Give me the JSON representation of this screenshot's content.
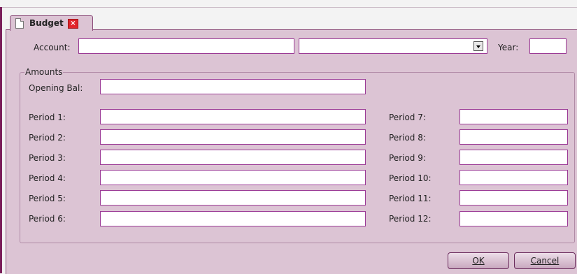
{
  "tab": {
    "title": "Budget",
    "close_glyph": "×"
  },
  "header": {
    "account_label": "Account:",
    "account_value": "",
    "account_name_value": "",
    "year_label": "Year:",
    "year_value": ""
  },
  "amounts": {
    "legend": "Amounts",
    "opening_bal_label": "Opening Bal:",
    "opening_bal_value": "",
    "periods": [
      {
        "label": "Period 1:",
        "value": ""
      },
      {
        "label": "Period 2:",
        "value": ""
      },
      {
        "label": "Period 3:",
        "value": ""
      },
      {
        "label": "Period 4:",
        "value": ""
      },
      {
        "label": "Period 5:",
        "value": ""
      },
      {
        "label": "Period 6:",
        "value": ""
      },
      {
        "label": "Period 7:",
        "value": ""
      },
      {
        "label": "Period 8:",
        "value": ""
      },
      {
        "label": "Period 9:",
        "value": ""
      },
      {
        "label": "Period 10:",
        "value": ""
      },
      {
        "label": "Period 11:",
        "value": ""
      },
      {
        "label": "Period 12:",
        "value": ""
      }
    ]
  },
  "buttons": {
    "ok": "OK",
    "cancel": "Cancel"
  },
  "icons": {
    "tab": "document-icon",
    "close": "close-icon",
    "dropdown": "chevron-down-icon"
  },
  "colors": {
    "panel_bg": "#dcc4d4",
    "input_border": "#9b3b96",
    "close_red": "#e2242b"
  }
}
